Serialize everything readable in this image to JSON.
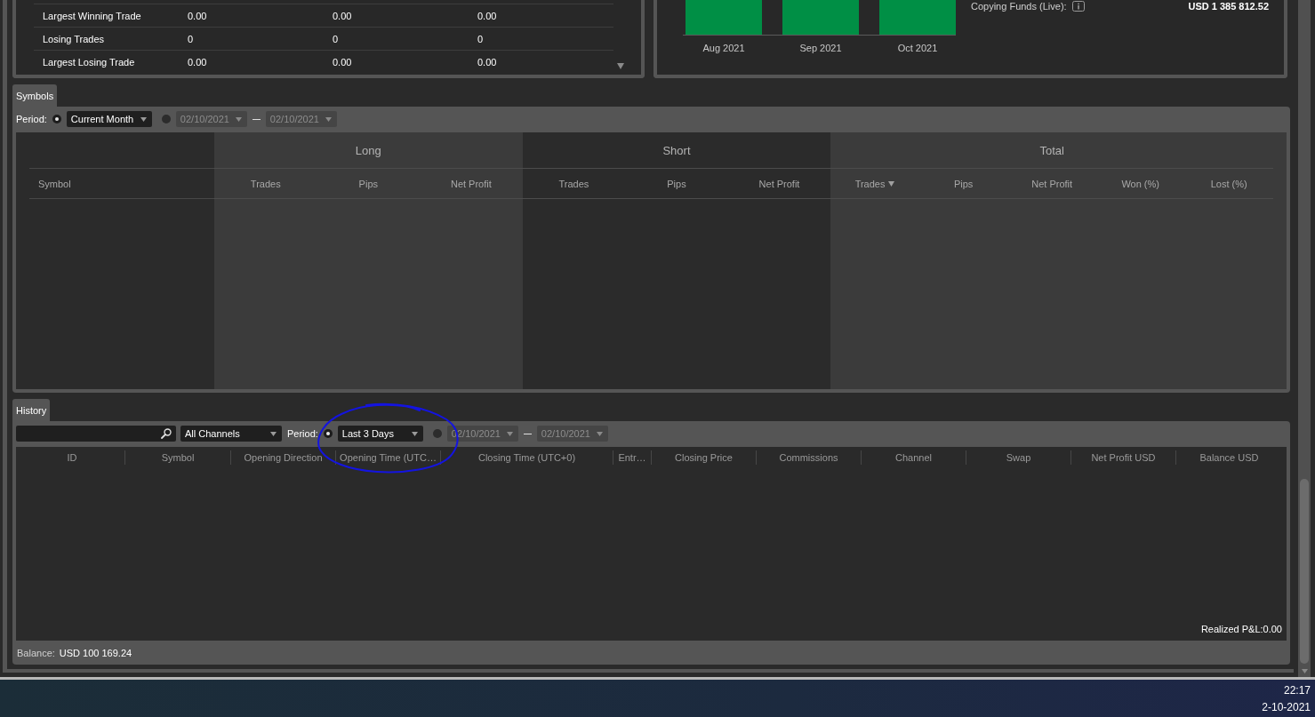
{
  "stats_table": {
    "rows": [
      {
        "label": "Largest Winning Trade",
        "values": [
          "0.00",
          "0.00",
          "0.00"
        ]
      },
      {
        "label": "Losing Trades",
        "values": [
          "0",
          "0",
          "0"
        ]
      },
      {
        "label": "Largest Losing Trade",
        "values": [
          "0.00",
          "0.00",
          "0.00"
        ]
      }
    ]
  },
  "monthly_chart": {
    "bars": [
      {
        "label": "Aug 2021"
      },
      {
        "label": "Sep 2021"
      },
      {
        "label": "Oct 2021"
      }
    ]
  },
  "copying_funds": {
    "label": "Copying Funds (Live):",
    "value": "USD 1 385 812.52"
  },
  "symbols": {
    "tab": {
      "label": "Symbols",
      "selected": true
    },
    "period": {
      "label": "Period:",
      "options": [
        {
          "kind": "preset",
          "selected": true,
          "value": "Current Month"
        },
        {
          "kind": "range",
          "selected": false,
          "from": "02/10/2021",
          "to": "02/10/2021"
        }
      ]
    },
    "table": {
      "symbol_header": "Symbol",
      "groups": [
        {
          "label": "Long",
          "columns": [
            {
              "label": "Trades",
              "sorted": false
            },
            {
              "label": "Pips",
              "sorted": false
            },
            {
              "label": "Net Profit",
              "sorted": false
            }
          ]
        },
        {
          "label": "Short",
          "columns": [
            {
              "label": "Trades",
              "sorted": false
            },
            {
              "label": "Pips",
              "sorted": false
            },
            {
              "label": "Net Profit",
              "sorted": false
            }
          ]
        },
        {
          "label": "Total",
          "columns": [
            {
              "label": "Trades",
              "sorted": true
            },
            {
              "label": "Pips",
              "sorted": false
            },
            {
              "label": "Net Profit",
              "sorted": false
            },
            {
              "label": "Won (%)",
              "sorted": false
            },
            {
              "label": "Lost (%)",
              "sorted": false
            }
          ]
        }
      ]
    }
  },
  "history": {
    "tab": {
      "label": "History",
      "selected": true
    },
    "channel": "All Channels",
    "period": {
      "label": "Period:",
      "options": [
        {
          "kind": "preset",
          "selected": true,
          "value": "Last 3 Days"
        },
        {
          "kind": "range",
          "selected": false,
          "from": "02/10/2021",
          "to": "02/10/2021"
        }
      ]
    },
    "columns": [
      "ID",
      "Symbol",
      "Opening Direction",
      "Opening Time (UTC…",
      "Closing Time (UTC+0)",
      "Entr…",
      "Closing Price",
      "Commissions",
      "Channel",
      "Swap",
      "Net Profit USD",
      "Balance USD"
    ],
    "realized_pnl": "Realized P&L:0.00",
    "balance": {
      "label": "Balance:",
      "value": "USD 100 169.24"
    }
  },
  "taskbar": {
    "time": "22:17",
    "date": "2-10-2021"
  }
}
